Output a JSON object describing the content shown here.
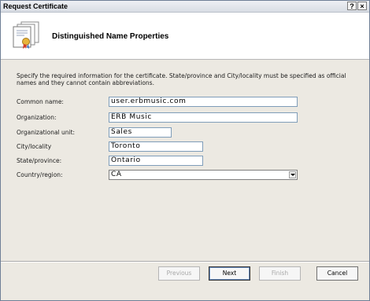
{
  "window": {
    "title": "Request Certificate",
    "help_label": "?",
    "close_label": "×"
  },
  "header": {
    "title": "Distinguished Name Properties",
    "icon": "certificate-icon"
  },
  "description": "Specify the required information for the certificate. State/province and City/locality must be specified as official names and they cannot contain abbreviations.",
  "form": {
    "common_name": {
      "label": "Common name:",
      "value": "user.erbmusic.com"
    },
    "organization": {
      "label": "Organization:",
      "value": "ERB Music"
    },
    "organizational_unit": {
      "label": "Organizational unit:",
      "value": "Sales"
    },
    "city": {
      "label": "City/locality",
      "value": "Toronto"
    },
    "state": {
      "label": "State/province:",
      "value": "Ontario"
    },
    "country": {
      "label": "Country/region:",
      "value": "CA"
    }
  },
  "buttons": {
    "previous": "Previous",
    "next": "Next",
    "finish": "Finish",
    "cancel": "Cancel"
  }
}
